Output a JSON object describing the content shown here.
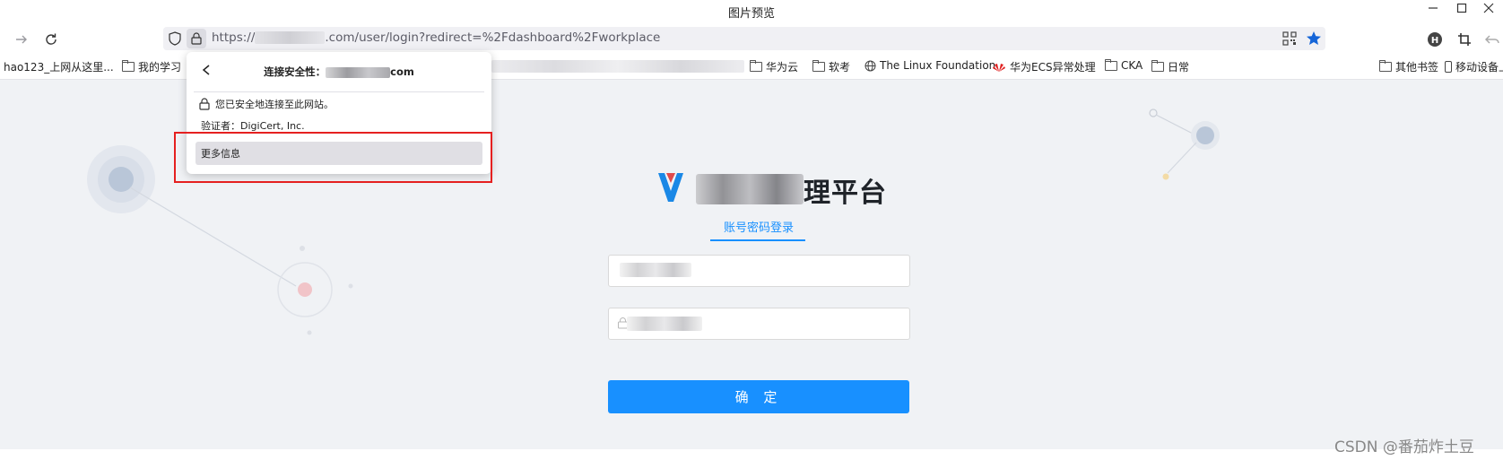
{
  "window": {
    "title": "图片预览"
  },
  "toolbar": {
    "url_prefix": "https://",
    "url_suffix": ".com/user/login?redirect=%2Fdashboard%2Fworkplace"
  },
  "bookmarks": {
    "items": [
      {
        "label": "hao123_上网从这里...",
        "icon": "none"
      },
      {
        "label": "我的学习",
        "icon": "folder-icon"
      },
      {
        "label": "华为云",
        "icon": "folder-icon"
      },
      {
        "label": "软考",
        "icon": "folder-icon"
      },
      {
        "label": "The Linux Foundation",
        "icon": "globe-icon"
      },
      {
        "label": "华为ECS异常处理",
        "icon": "huawei-icon"
      },
      {
        "label": "CKA",
        "icon": "folder-icon"
      },
      {
        "label": "日常",
        "icon": "folder-icon"
      }
    ],
    "right_items": [
      {
        "label": "其他书签",
        "icon": "folder-icon"
      },
      {
        "label": "移动设备上",
        "icon": "mobile-icon"
      }
    ]
  },
  "popup": {
    "title_prefix": "连接安全性：",
    "title_suffix": "com",
    "secure_text": "您已安全地连接至此网站。",
    "verifier_text": "验证者：DigiCert, Inc.",
    "more_info_label": "更多信息"
  },
  "login": {
    "title_visible": "理平台",
    "tab_label": "账号密码登录",
    "submit_label": "确 定"
  },
  "watermark": "CSDN @番茄炸土豆",
  "colors": {
    "accent": "#1890ff",
    "page_bg": "#f0f2f5",
    "highlight": "#e52020"
  }
}
